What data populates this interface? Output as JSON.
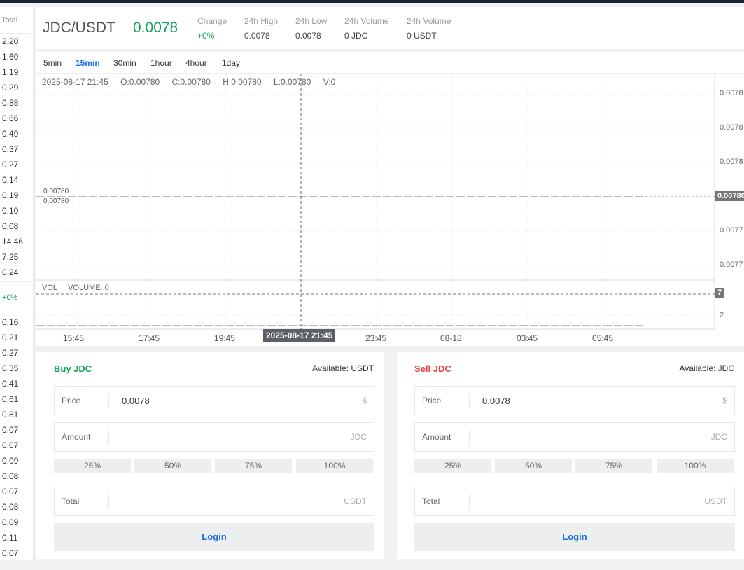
{
  "orderbook": {
    "header": "Total",
    "asks": [
      "2.20",
      "1.60",
      "1.19",
      "0.29",
      "0.88",
      "0.66",
      "0.49",
      "0.37",
      "0.27",
      "0.14",
      "0.19",
      "0.10",
      "0.08",
      "14.46",
      "7.25",
      "0.24"
    ],
    "mid_change": "+0%",
    "bids": [
      "0.16",
      "0.21",
      "0.27",
      "0.35",
      "0.41",
      "0.61",
      "0.81",
      "0.07",
      "0.07",
      "0.09",
      "0.08",
      "0.07",
      "0.08",
      "0.09",
      "0.11",
      "0.07"
    ]
  },
  "ticker": {
    "pair": "JDC/USDT",
    "last_price": "0.0078",
    "stats": [
      {
        "label": "Change",
        "value": "+0%"
      },
      {
        "label": "24h High",
        "value": "0.0078"
      },
      {
        "label": "24h Low",
        "value": "0.0078"
      },
      {
        "label": "24h Volume",
        "value": "0 JDC"
      },
      {
        "label": "24h Volume",
        "value": "0 USDT"
      }
    ]
  },
  "chart": {
    "intervals": [
      "5min",
      "15min",
      "30min",
      "1hour",
      "4hour",
      "1day"
    ],
    "active_interval": "15min",
    "ohlc": {
      "time": "2025-08-17 21:45",
      "open": "O:0.00780",
      "close": "C:0.00780",
      "high": "H:0.00780",
      "low": "L:0.00780",
      "volume": "V:0"
    },
    "high_label": "0.00780",
    "low_label": "0.00780",
    "y_ticks": [
      "0.0078",
      "0.0078",
      "0.0078",
      "0.0077",
      "0.0077"
    ],
    "price_tag": "0.00780",
    "volume_legend": {
      "name": "VOL",
      "text": "VOLUME: 0"
    },
    "volume_tag": "7",
    "volume_tick": "2",
    "x_ticks": [
      "15:45",
      "17:45",
      "19:45",
      "23:45",
      "08-18",
      "03:45",
      "05:45"
    ],
    "crosshair_time": "2025-08-17 21:45"
  },
  "buy": {
    "title": "Buy JDC",
    "available": "Available: USDT",
    "price_label": "Price",
    "price_value": "0.0078",
    "price_unit": "$",
    "amount_label": "Amount",
    "amount_unit": "JDC",
    "percents": [
      "25%",
      "50%",
      "75%",
      "100%"
    ],
    "total_label": "Total",
    "total_unit": "USDT",
    "login": "Login"
  },
  "sell": {
    "title": "Sell JDC",
    "available": "Available: JDC",
    "price_label": "Price",
    "price_value": "0.0078",
    "price_unit": "$",
    "amount_label": "Amount",
    "amount_unit": "JDC",
    "percents": [
      "25%",
      "50%",
      "75%",
      "100%"
    ],
    "total_label": "Total",
    "total_unit": "USDT",
    "login": "Login"
  },
  "colors": {
    "up": "#14a35a",
    "down": "#e64545",
    "accent": "#1e6fe3"
  }
}
